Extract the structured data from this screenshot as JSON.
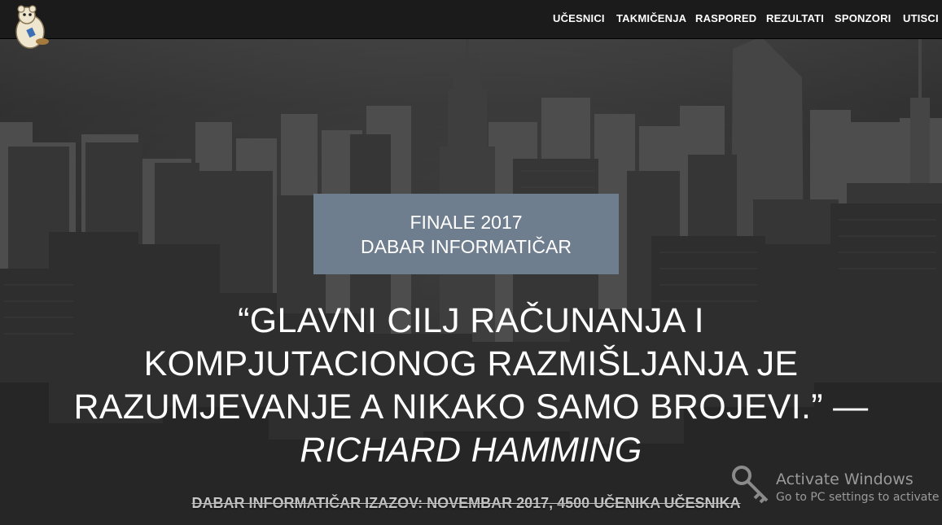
{
  "navbar": {
    "logo_icon": "beaver-mascot-icon",
    "items": [
      {
        "label": "UČESNICI"
      },
      {
        "label": "TAKMIČENJA"
      },
      {
        "label": "RASPORED"
      },
      {
        "label": "REZULTATI"
      },
      {
        "label": "SPONZORI"
      },
      {
        "label": "UTISCI"
      }
    ]
  },
  "hero": {
    "background": "city-skyline-photo",
    "title_line1": "FINALE 2017",
    "title_line2": "DABAR INFORMATIČAR",
    "quote_text": "“GLAVNI CILJ RAČUNANJA I KOMPJUTACIONOG RAZMIŠLJANJA JE RAZUMJEVANJE A NIKAKO SAMO BROJEVI.” — ",
    "quote_author": "RICHARD HAMMING",
    "tagline": "DABAR INFORMATIČAR IZAZOV: NOVEMBAR 2017, 4500 UČENIKA UČESNIKA"
  },
  "watermark": {
    "icon": "key-icon",
    "title": "Activate Windows",
    "subtitle": "Go to PC settings to activate W"
  },
  "colors": {
    "navbar_bg": "#1b1b1b",
    "title_box_bg": "#6f7e8e",
    "text": "#ffffff"
  }
}
